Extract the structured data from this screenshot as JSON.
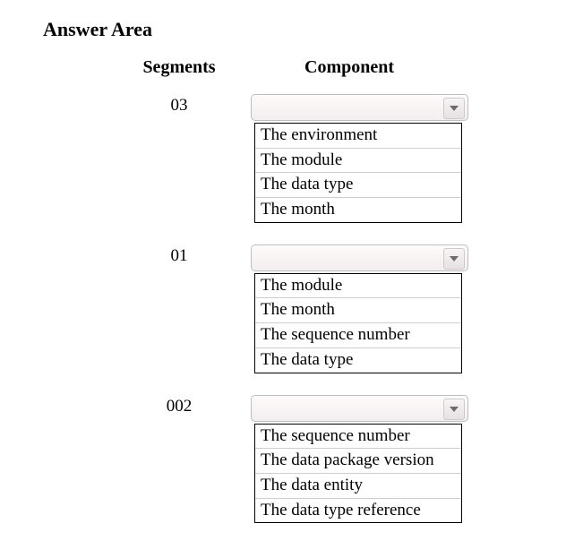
{
  "title": "Answer Area",
  "headers": {
    "segments": "Segments",
    "component": "Component"
  },
  "rows": [
    {
      "segment": "03",
      "options": [
        "The environment",
        "The module",
        "The data type",
        "The month"
      ]
    },
    {
      "segment": "01",
      "options": [
        "The module",
        "The month",
        "The sequence number",
        "The data type"
      ]
    },
    {
      "segment": "002",
      "options": [
        "The sequence number",
        "The data package version",
        "The data entity",
        "The data type reference"
      ]
    }
  ]
}
